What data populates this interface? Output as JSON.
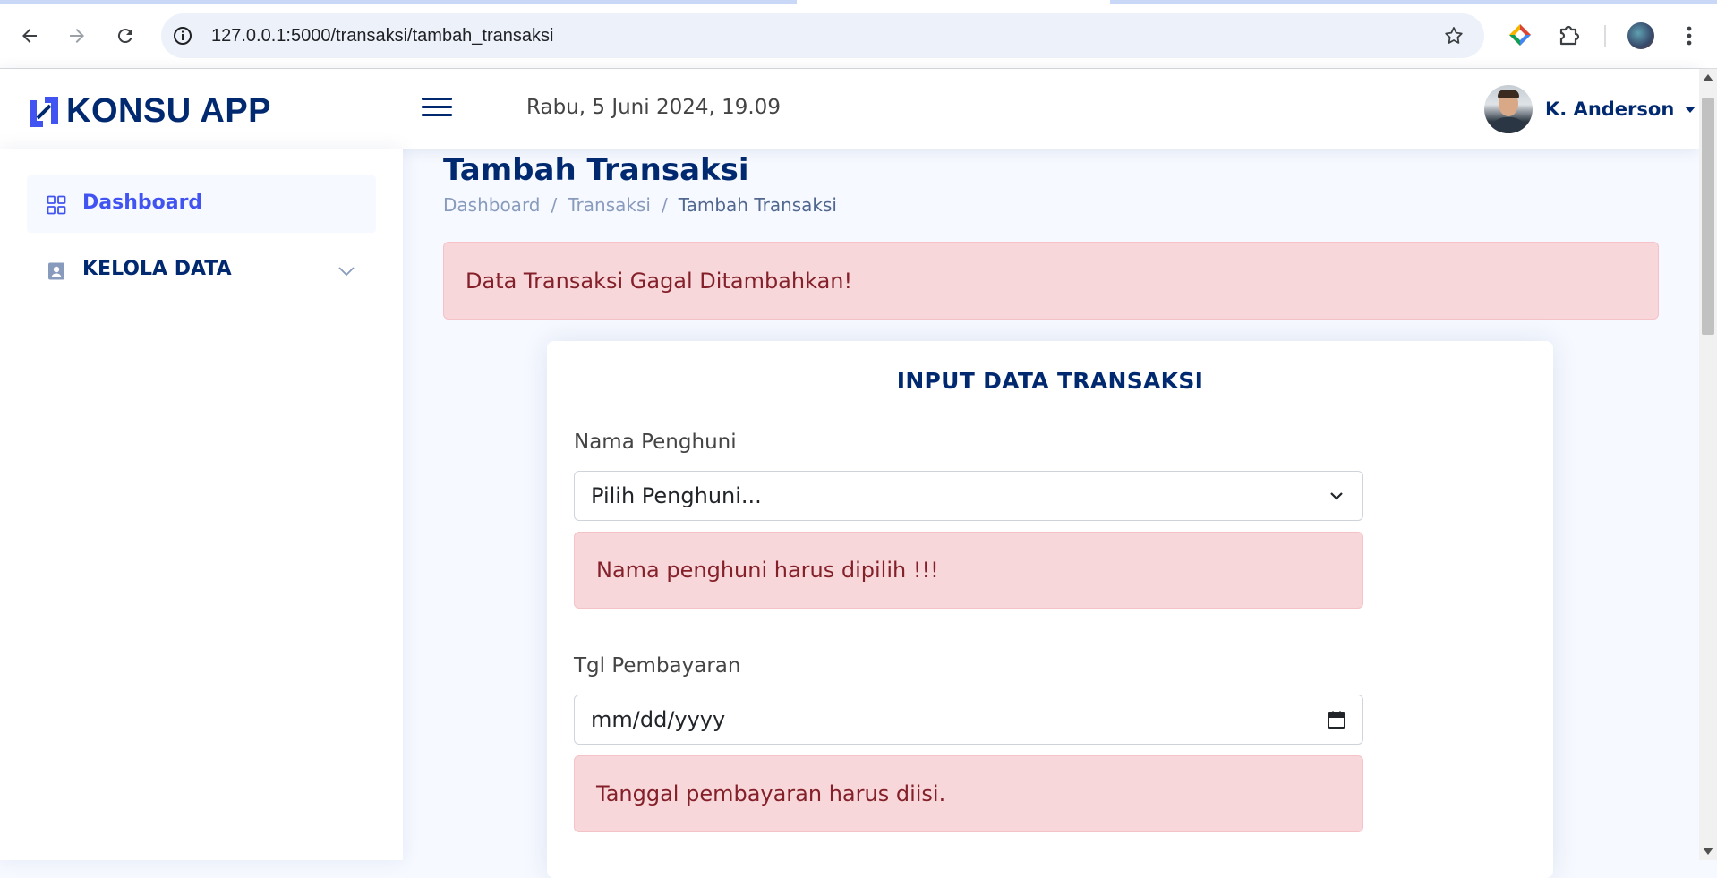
{
  "browser": {
    "url": "127.0.0.1:5000/transaksi/tambah_transaksi",
    "icons": [
      "back-icon",
      "forward-icon",
      "reload-icon",
      "site-info-icon",
      "bookmark-star-icon",
      "extension-color-icon",
      "extensions-puzzle-icon",
      "profile-avatar-icon",
      "menu-kebab-icon"
    ]
  },
  "header": {
    "logo_text": "KONSU APP",
    "datetime": "Rabu, 5 Juni 2024, 19.09",
    "user_name": "K. Anderson"
  },
  "sidebar": {
    "items": [
      {
        "label": "Dashboard",
        "icon": "grid-icon",
        "active": true
      },
      {
        "label": "KELOLA DATA",
        "icon": "person-badge-icon",
        "active": false
      }
    ]
  },
  "page": {
    "title": "Tambah Transaksi",
    "breadcrumb": [
      "Dashboard",
      "Transaksi",
      "Tambah Transaksi"
    ],
    "alert": "Data Transaksi Gagal Ditambahkan!"
  },
  "form": {
    "title": "INPUT DATA TRANSAKSI",
    "nama_label": "Nama Penghuni",
    "nama_value": "Pilih Penghuni...",
    "nama_error": "Nama penghuni harus dipilih !!!",
    "tgl_label": "Tgl Pembayaran",
    "tgl_value": "mm/dd/yyyy",
    "tgl_error": "Tanggal pembayaran harus diisi."
  },
  "colors": {
    "brand": "#012970",
    "accent": "#4154f1",
    "alert_bg": "#f8d7da",
    "alert_text": "#842029",
    "page_bg": "#f6f9ff"
  }
}
